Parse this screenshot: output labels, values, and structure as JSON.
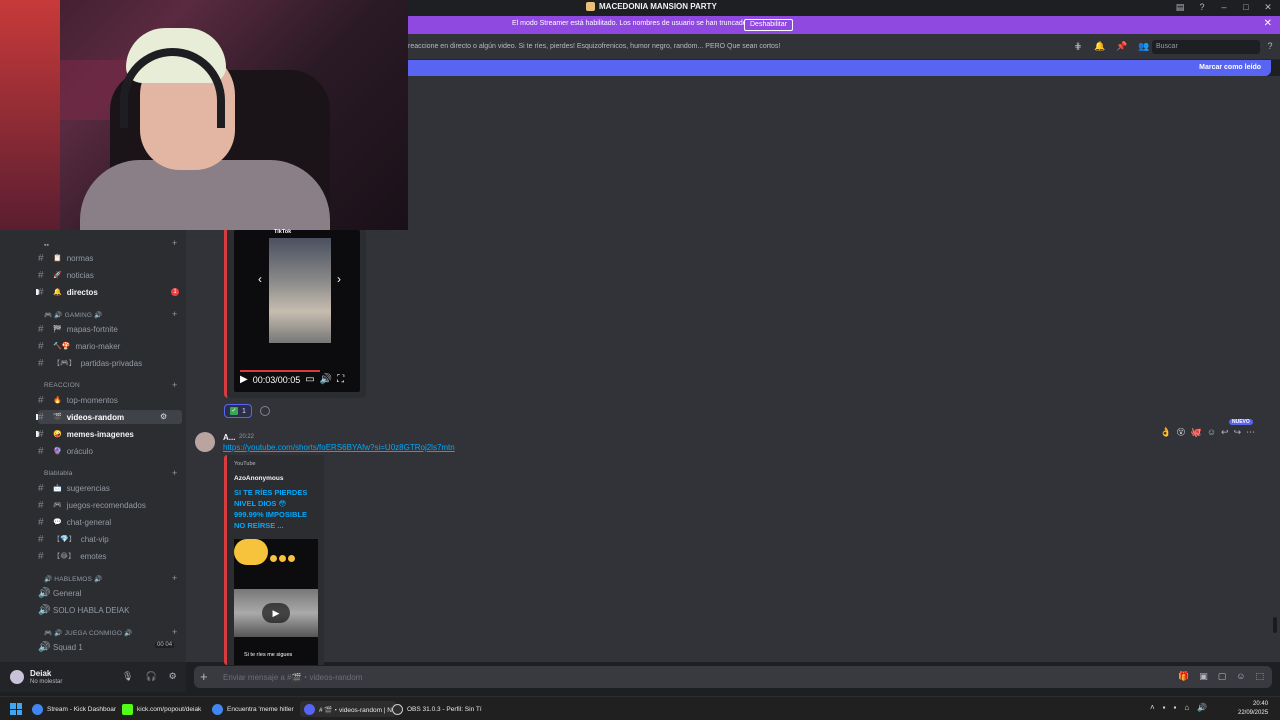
{
  "window": {
    "server_title": "MACEDONIA MANSION PARTY"
  },
  "banner": {
    "message": "El modo Streamer está habilitado. Los nombres de usuario se han truncado.",
    "button": "Deshabilitar"
  },
  "channel_header": {
    "topic": "reaccione en directo o algún video. Si te ríes, pierdes! Esquizofrenicos, humor negro, random... PERO Que sean cortos!",
    "search_placeholder": "Buscar"
  },
  "new_messages_bar": {
    "mark_read": "Marcar como leído"
  },
  "sidebar": {
    "channels": [
      {
        "label": "normas",
        "emoji": "📋"
      },
      {
        "label": "noticias",
        "emoji": "🚀"
      },
      {
        "label": "directos",
        "emoji": "🔔",
        "unread": true,
        "mentions": "1"
      },
      {
        "label": "mapas-fortnite",
        "emoji": "🏁"
      },
      {
        "label": "mario-maker",
        "emoji": "🔨🍄"
      },
      {
        "label": "partidas-privadas",
        "emoji": "【🎮】"
      },
      {
        "label": "top-momentos",
        "emoji": "🔥"
      },
      {
        "label": "videos-random",
        "emoji": "🎬"
      },
      {
        "label": "memes-imagenes",
        "emoji": "🤪"
      },
      {
        "label": "oráculo",
        "emoji": "🔮"
      },
      {
        "label": "sugerencias",
        "emoji": "📩"
      },
      {
        "label": "juegos-recomendados",
        "emoji": "🎮"
      },
      {
        "label": "chat-general",
        "emoji": "💬"
      },
      {
        "label": "chat-vip",
        "emoji": "【💎】"
      },
      {
        "label": "emotes",
        "emoji": "【😂】"
      }
    ],
    "categories": {
      "gaming": "🎮 🔊 GAMING 🔊",
      "reaccion": "REACCION",
      "blablabla": "Blablabla",
      "hablemos": "🔊 HABLEMOS 🔊",
      "juega": "🎮 🔊 JUEGA CONMIGO 🔊"
    },
    "voice": {
      "general": "General",
      "solo": "SOLO HABLA DEIAK",
      "squad": "Squad 1",
      "squad_count_a": "00",
      "squad_count_b": "04"
    }
  },
  "user": {
    "name": "Deiak",
    "status": "No molestar"
  },
  "tiktok_embed": {
    "label": "TikTok",
    "time": "00:03/00:05"
  },
  "reaction": {
    "count": "1"
  },
  "message": {
    "author": "A...",
    "time": "20:22",
    "link": "https://youtube.com/shorts/foERS6BYAfw?si=U0z8GTRoj2ls7mtn",
    "badge": "NUEVO"
  },
  "youtube_embed": {
    "provider": "YouTube",
    "author": "AzoAnonymous",
    "title_lines": [
      "SI TE RÍES PIERDES",
      "NIVEL DIOS 😳",
      "999.99% IMPOSIBLE",
      "NO REÍRSE ..."
    ],
    "caption": "Si te ríes me sigues"
  },
  "composer": {
    "placeholder": "Enviar mensaje a #🎬・videos-random"
  },
  "taskbar": {
    "items": [
      "Stream - Kick Dashboar",
      "kick.com/popout/deiak",
      "Encuentra 'meme hitler",
      "# 🎬・videos-random | N",
      "OBS 31.0.3 - Perfil: Sin Tí"
    ],
    "time": "20:40",
    "date": "22/09/2025"
  }
}
